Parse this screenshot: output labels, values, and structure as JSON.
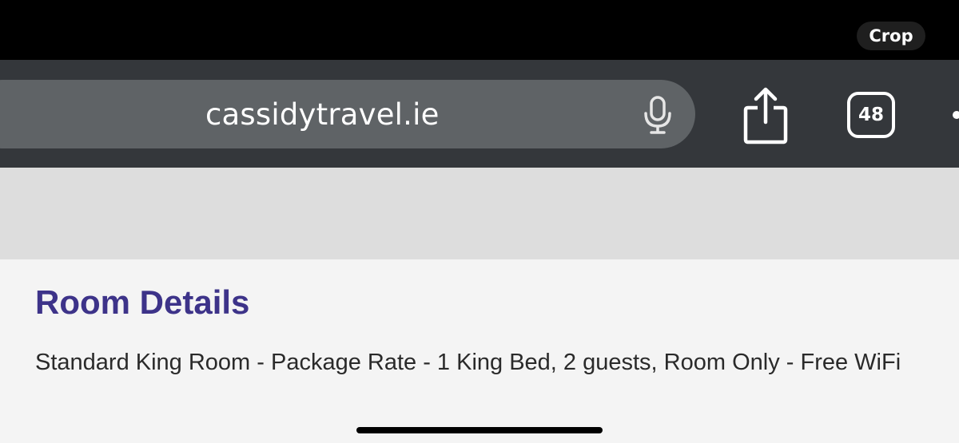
{
  "overlay": {
    "crop_label": "Crop"
  },
  "browser": {
    "url": "cassidytravel.ie",
    "tab_count": "48",
    "icons": {
      "voice": "microphone-icon",
      "share": "share-icon",
      "tabs": "tabs-icon",
      "more": "more-icon"
    }
  },
  "page": {
    "section_title": "Room Details",
    "room_description": "Standard King Room - Package Rate - 1 King Bed, 2 guests, Room Only - Free WiFi"
  },
  "colors": {
    "toolbar_bg": "#34373b",
    "address_bar_bg": "#5f6366",
    "title_color": "#3d3389",
    "band_bg": "#dddddd",
    "page_bg": "#f4f4f4"
  }
}
